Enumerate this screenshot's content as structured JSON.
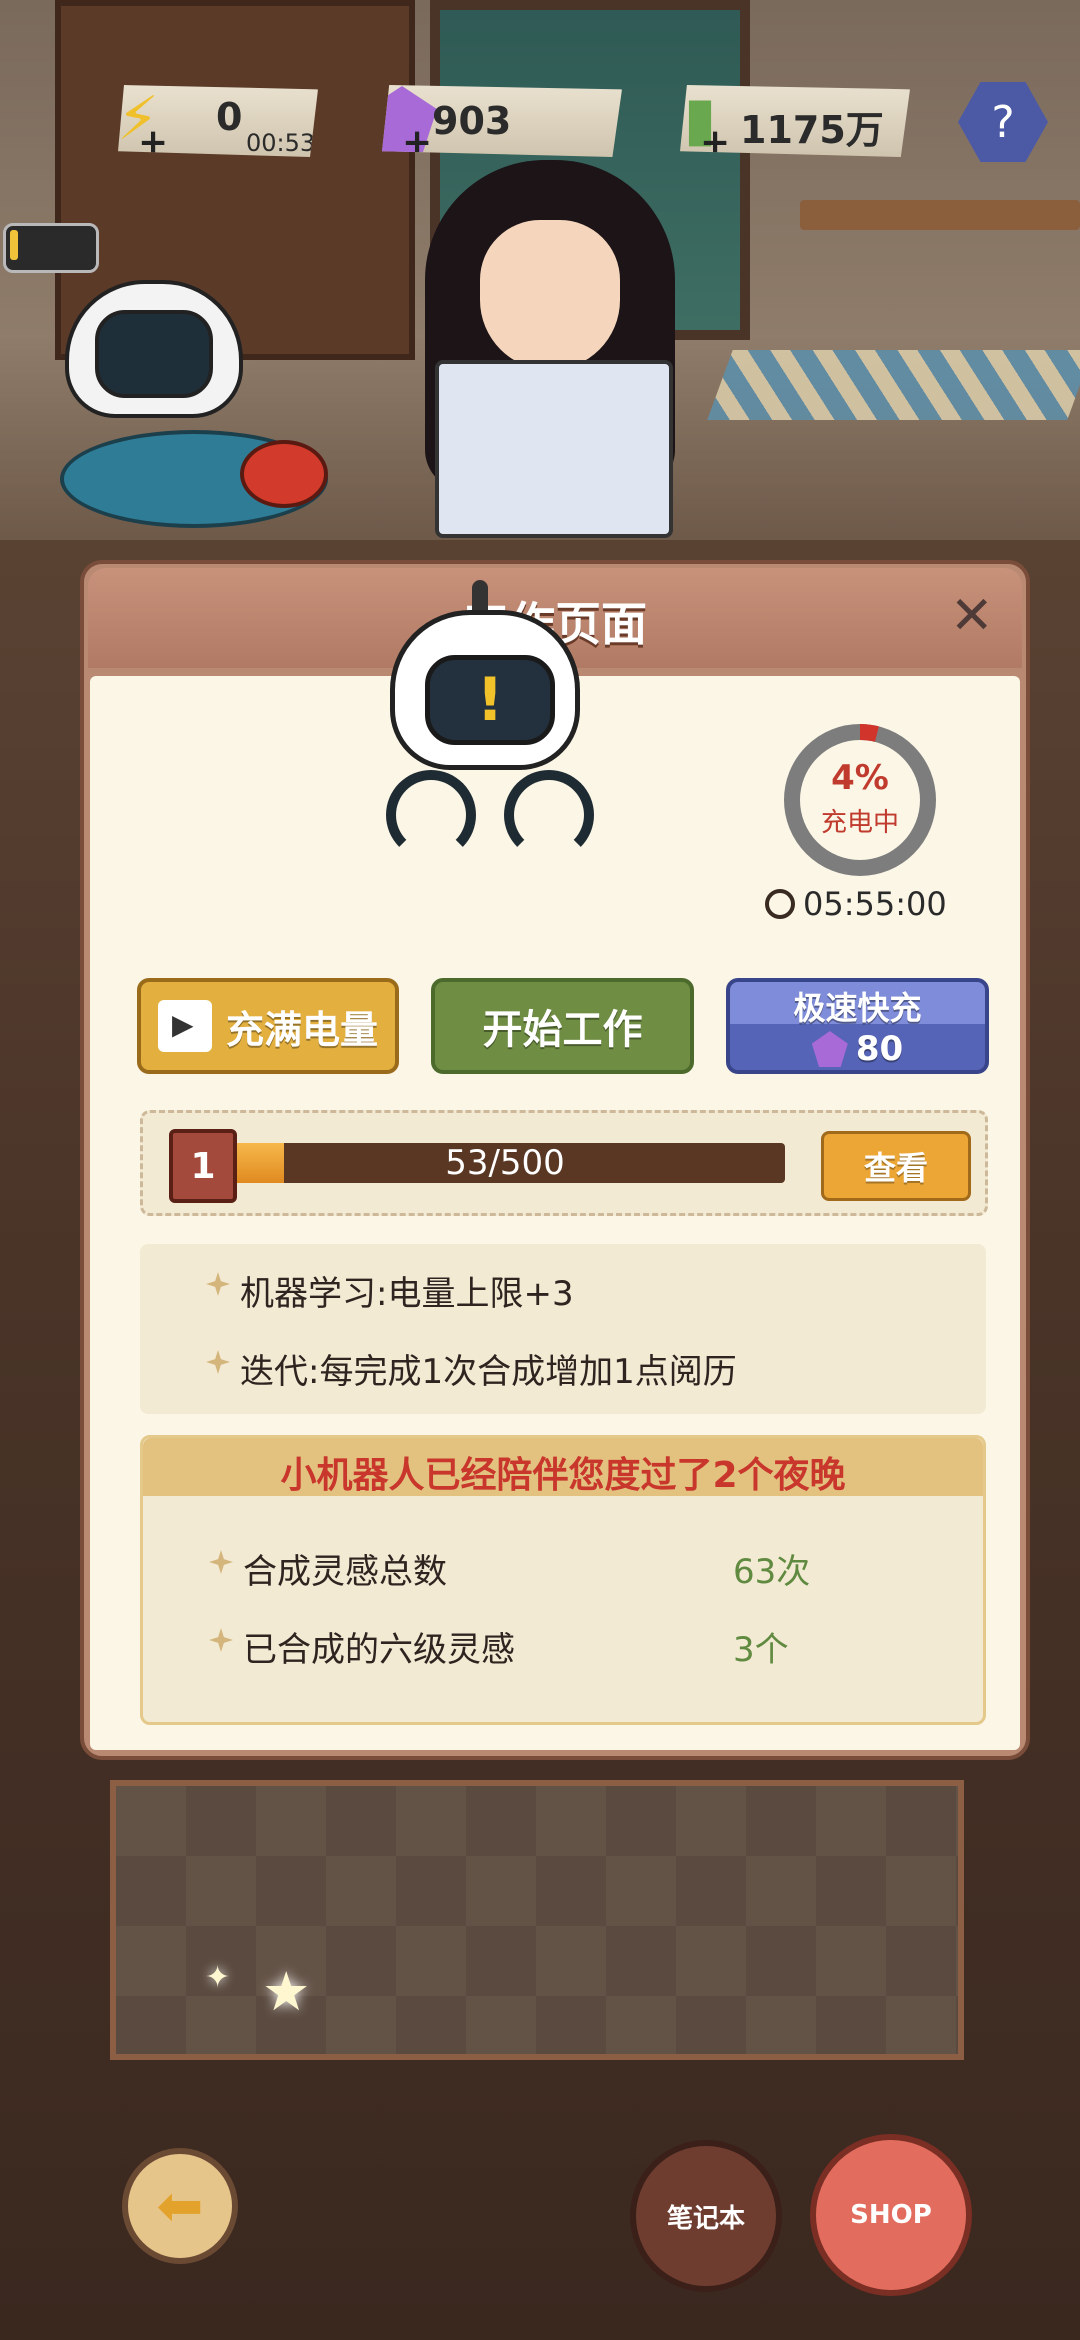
{
  "resources": {
    "energy": {
      "value": "0",
      "timer": "00:53",
      "icon": "lightning-icon"
    },
    "gems": {
      "value": "903",
      "icon": "gem-icon"
    },
    "money": {
      "value": "1175万",
      "icon": "cash-icon"
    }
  },
  "panel": {
    "title": "工作页面",
    "close_icon": "close-icon",
    "charge": {
      "percent_text": "4%",
      "status": "充电中",
      "timer": "05:55:00",
      "fraction": 0.04
    },
    "buttons": {
      "fill_energy": "充满电量",
      "start_work": "开始工作",
      "fast_charge_title": "极速快充",
      "fast_charge_cost": "80"
    },
    "level": {
      "badge": "1",
      "progress_text": "53/500",
      "progress_fraction": 0.106,
      "view_button": "查看"
    },
    "skills": [
      "机器学习:电量上限+3",
      "迭代:每完成1次合成增加1点阅历"
    ],
    "stats": {
      "title": "小机器人已经陪伴您度过了2个夜晚",
      "rows": [
        {
          "label": "合成灵感总数",
          "value": "63次"
        },
        {
          "label": "已合成的六级灵感",
          "value": "3个"
        }
      ]
    }
  },
  "bottom": {
    "notebook_label": "笔记本",
    "shop_label": "SHOP"
  },
  "colors": {
    "accent_red": "#c03a2e",
    "green_value": "#5f8a3f",
    "work_green": "#6f8d43",
    "fast_blue": "#5564b6"
  }
}
